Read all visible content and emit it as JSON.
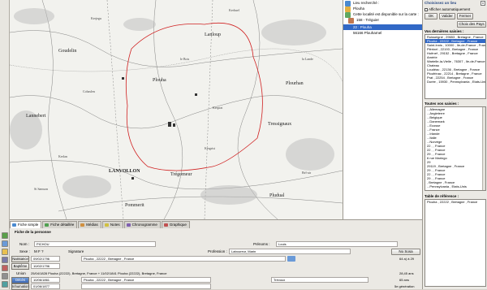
{
  "left_toolbar": {
    "icons": [
      "globe-icon",
      "tree-icon",
      "search-icon",
      "list-icon",
      "print-icon",
      "settings-icon",
      "edit-icon"
    ]
  },
  "map": {
    "labels": [
      {
        "text": "Plouha",
        "size": "big"
      },
      {
        "text": "Lanloup",
        "size": "big"
      },
      {
        "text": "Lannebert",
        "size": "big"
      },
      {
        "text": "Tressignaux",
        "size": "big"
      },
      {
        "text": "Pludual",
        "size": "big"
      },
      {
        "text": "Pommerit",
        "size": "big"
      },
      {
        "text": "LANVOLLON",
        "size": "big"
      },
      {
        "text": "Trégomeur",
        "size": "big"
      },
      {
        "text": "Goudelin",
        "size": "big"
      },
      {
        "text": "Plourhan",
        "size": "big"
      },
      {
        "text": "Kerjegu",
        "size": "sm"
      },
      {
        "text": "Kerhuel",
        "size": "sm"
      },
      {
        "text": "le Bois",
        "size": "sm"
      },
      {
        "text": "la Lande",
        "size": "sm"
      },
      {
        "text": "Kergrist",
        "size": "sm"
      },
      {
        "text": "Cohaslen",
        "size": "sm"
      },
      {
        "text": "Kerlan",
        "size": "sm"
      },
      {
        "text": "Bel-air",
        "size": "sm"
      },
      {
        "text": "Kerprat",
        "size": "sm"
      },
      {
        "text": "St Samson",
        "size": "sm"
      }
    ]
  },
  "search_panel": {
    "header": "Lieu recherché :",
    "query": "Plouha",
    "not_available": "Cette localité est disponible sur la carte :",
    "count_line": "158 - Tréguier",
    "results": [
      {
        "label": "22 : Plouha",
        "selected": true
      },
      {
        "label": "56166 Plouharnel",
        "selected": false
      }
    ]
  },
  "right_panel": {
    "title": "Choisissez un lieu",
    "close": "x",
    "auto_display": "Afficher automatiquement",
    "buttons": {
      "ok": "OK",
      "validate": "Valider",
      "close": "Fermer",
      "choose": "Choix des Pays"
    },
    "recent_title": "Vos dernières saisies :",
    "recent": [
      "Ruisseigné , 29653 , Bretagne , France",
      "Plouha , 22222 , Bretagne , France",
      "Saint-Innis , 10000 , Ile-de-France , France",
      "Plérinel , 22193 , Bretagne , France",
      "Hoënef , 29152 , Bretagne , France",
      "Amérie",
      "Wartelle-la-Vielle , 76307 , Ile-de-France , France",
      "Chateau",
      "Loudéac , 22136 , Bretagne , France",
      "Ploufrinac , 22214 , Bretagne , France",
      "Prat , 22254 , Bretagne , France",
      "Durée , 15930 , Pennsylvania , Etats-Unis"
    ],
    "all_title": "Toutes vos saisies :",
    "all": [
      "...Allemagne",
      "...Angleterre",
      "...Belgique",
      "...Danemark",
      "...Ecosse",
      "...France",
      "...Irlande",
      "...Italie",
      "...Norvège",
      "22 , , France",
      "22 , , France",
      "29 , , France",
      "6 rue Maringo",
      "29",
      "29119 , Bretagne , France",
      "29 , , France",
      "22 , , France",
      "29 , , France",
      ", Bretagne , France",
      "...Pennsylvania , Etats-Unis"
    ],
    "ref_title": "Table de référence :",
    "ref_value": "Plouha , 22222 , Bretagne , France"
  },
  "bottom": {
    "tabs": [
      {
        "label": "Fiche simple",
        "active": true
      },
      {
        "label": "Fiche détaillée",
        "active": false
      },
      {
        "label": "Médias",
        "active": false
      },
      {
        "label": "Notes",
        "active": false
      },
      {
        "label": "Chronogramme",
        "active": false
      },
      {
        "label": "Graphique",
        "active": false
      }
    ],
    "fiche_title": "Fiche de la personne",
    "nom_label": "Nom :",
    "nom_value": "PICHOU",
    "prenoms_label": "Prénoms :",
    "prenoms_value": "Louis",
    "sexe_label": "Sexe :",
    "sexe_options": "M   F   ?",
    "signature_label": "Signature",
    "profession_label": "Profession :",
    "profession_value": "Laboureur, Marin",
    "no_sosa": "No Sosa",
    "naissance_btn": "Naissance",
    "naissance_date": "09/02/1796",
    "naissance_place": "Plouha , 22222 , Bretagne , France",
    "naissance_age": "64 a) à 29",
    "bapteme_btn": "Baptême",
    "bapteme_date": "10/02/1796",
    "union_label": "Union",
    "union_text": "25/04/1828 Plouha (22222), Bretagne, France + 11/02/1841 Plouha (22222), Bretagne, France",
    "union_age": "28,45 ans",
    "deces_btn": "Décès",
    "deces_date": "10/06/1861",
    "deces_place": "Plouha , 22222 , Bretagne , France",
    "deces_extra": "Trévoux",
    "deces_age": "65 ans",
    "inhumation_btn": "Inhumation",
    "inhumation_date": "01/06/1877",
    "inhumation_age": "5e génération"
  }
}
